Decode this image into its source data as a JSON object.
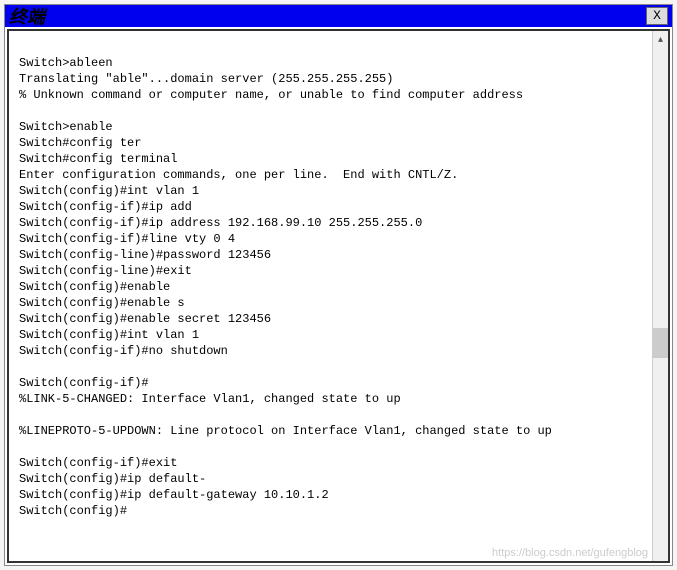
{
  "window": {
    "title": "终端",
    "close_label": "X"
  },
  "terminal": {
    "lines": [
      "",
      "Switch>ableen",
      "Translating \"able\"...domain server (255.255.255.255)",
      "% Unknown command or computer name, or unable to find computer address",
      "",
      "Switch>enable",
      "Switch#config ter",
      "Switch#config terminal",
      "Enter configuration commands, one per line.  End with CNTL/Z.",
      "Switch(config)#int vlan 1",
      "Switch(config-if)#ip add",
      "Switch(config-if)#ip address 192.168.99.10 255.255.255.0",
      "Switch(config-if)#line vty 0 4",
      "Switch(config-line)#password 123456",
      "Switch(config-line)#exit",
      "Switch(config)#enable",
      "Switch(config)#enable s",
      "Switch(config)#enable secret 123456",
      "Switch(config)#int vlan 1",
      "Switch(config-if)#no shutdown",
      "",
      "Switch(config-if)#",
      "%LINK-5-CHANGED: Interface Vlan1, changed state to up",
      "",
      "%LINEPROTO-5-UPDOWN: Line protocol on Interface Vlan1, changed state to up",
      "",
      "Switch(config-if)#exit",
      "Switch(config)#ip default-",
      "Switch(config)#ip default-gateway 10.10.1.2",
      "Switch(config)#"
    ]
  },
  "scrollbar": {
    "up_glyph": "▴"
  },
  "watermark": "https://blog.csdn.net/gufengblog"
}
